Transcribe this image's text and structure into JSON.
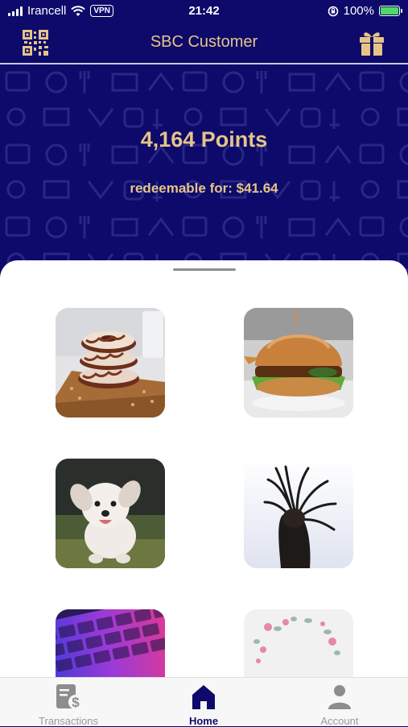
{
  "status_bar": {
    "carrier": "Irancell",
    "vpn": "VPN",
    "time": "21:42",
    "battery": "100%"
  },
  "header": {
    "title": "SBC Customer"
  },
  "rewards": {
    "points": "4,164 Points",
    "redeemable": "redeemable for: $41.64"
  },
  "tiles": [
    {
      "icon": "donuts-image"
    },
    {
      "icon": "burger-image"
    },
    {
      "icon": "dog-image"
    },
    {
      "icon": "hair-flip-image"
    },
    {
      "icon": "keyboard-image"
    },
    {
      "icon": "flowers-image"
    }
  ],
  "tabs": [
    {
      "label": "Transactions",
      "icon": "receipt-dollar-icon",
      "active": false
    },
    {
      "label": "Home",
      "icon": "home-icon",
      "active": true
    },
    {
      "label": "Account",
      "icon": "person-icon",
      "active": false
    }
  ],
  "colors": {
    "brand_navy": "#0d0a6b",
    "accent_gold": "#e6c487",
    "battery_green": "#4cd964"
  }
}
